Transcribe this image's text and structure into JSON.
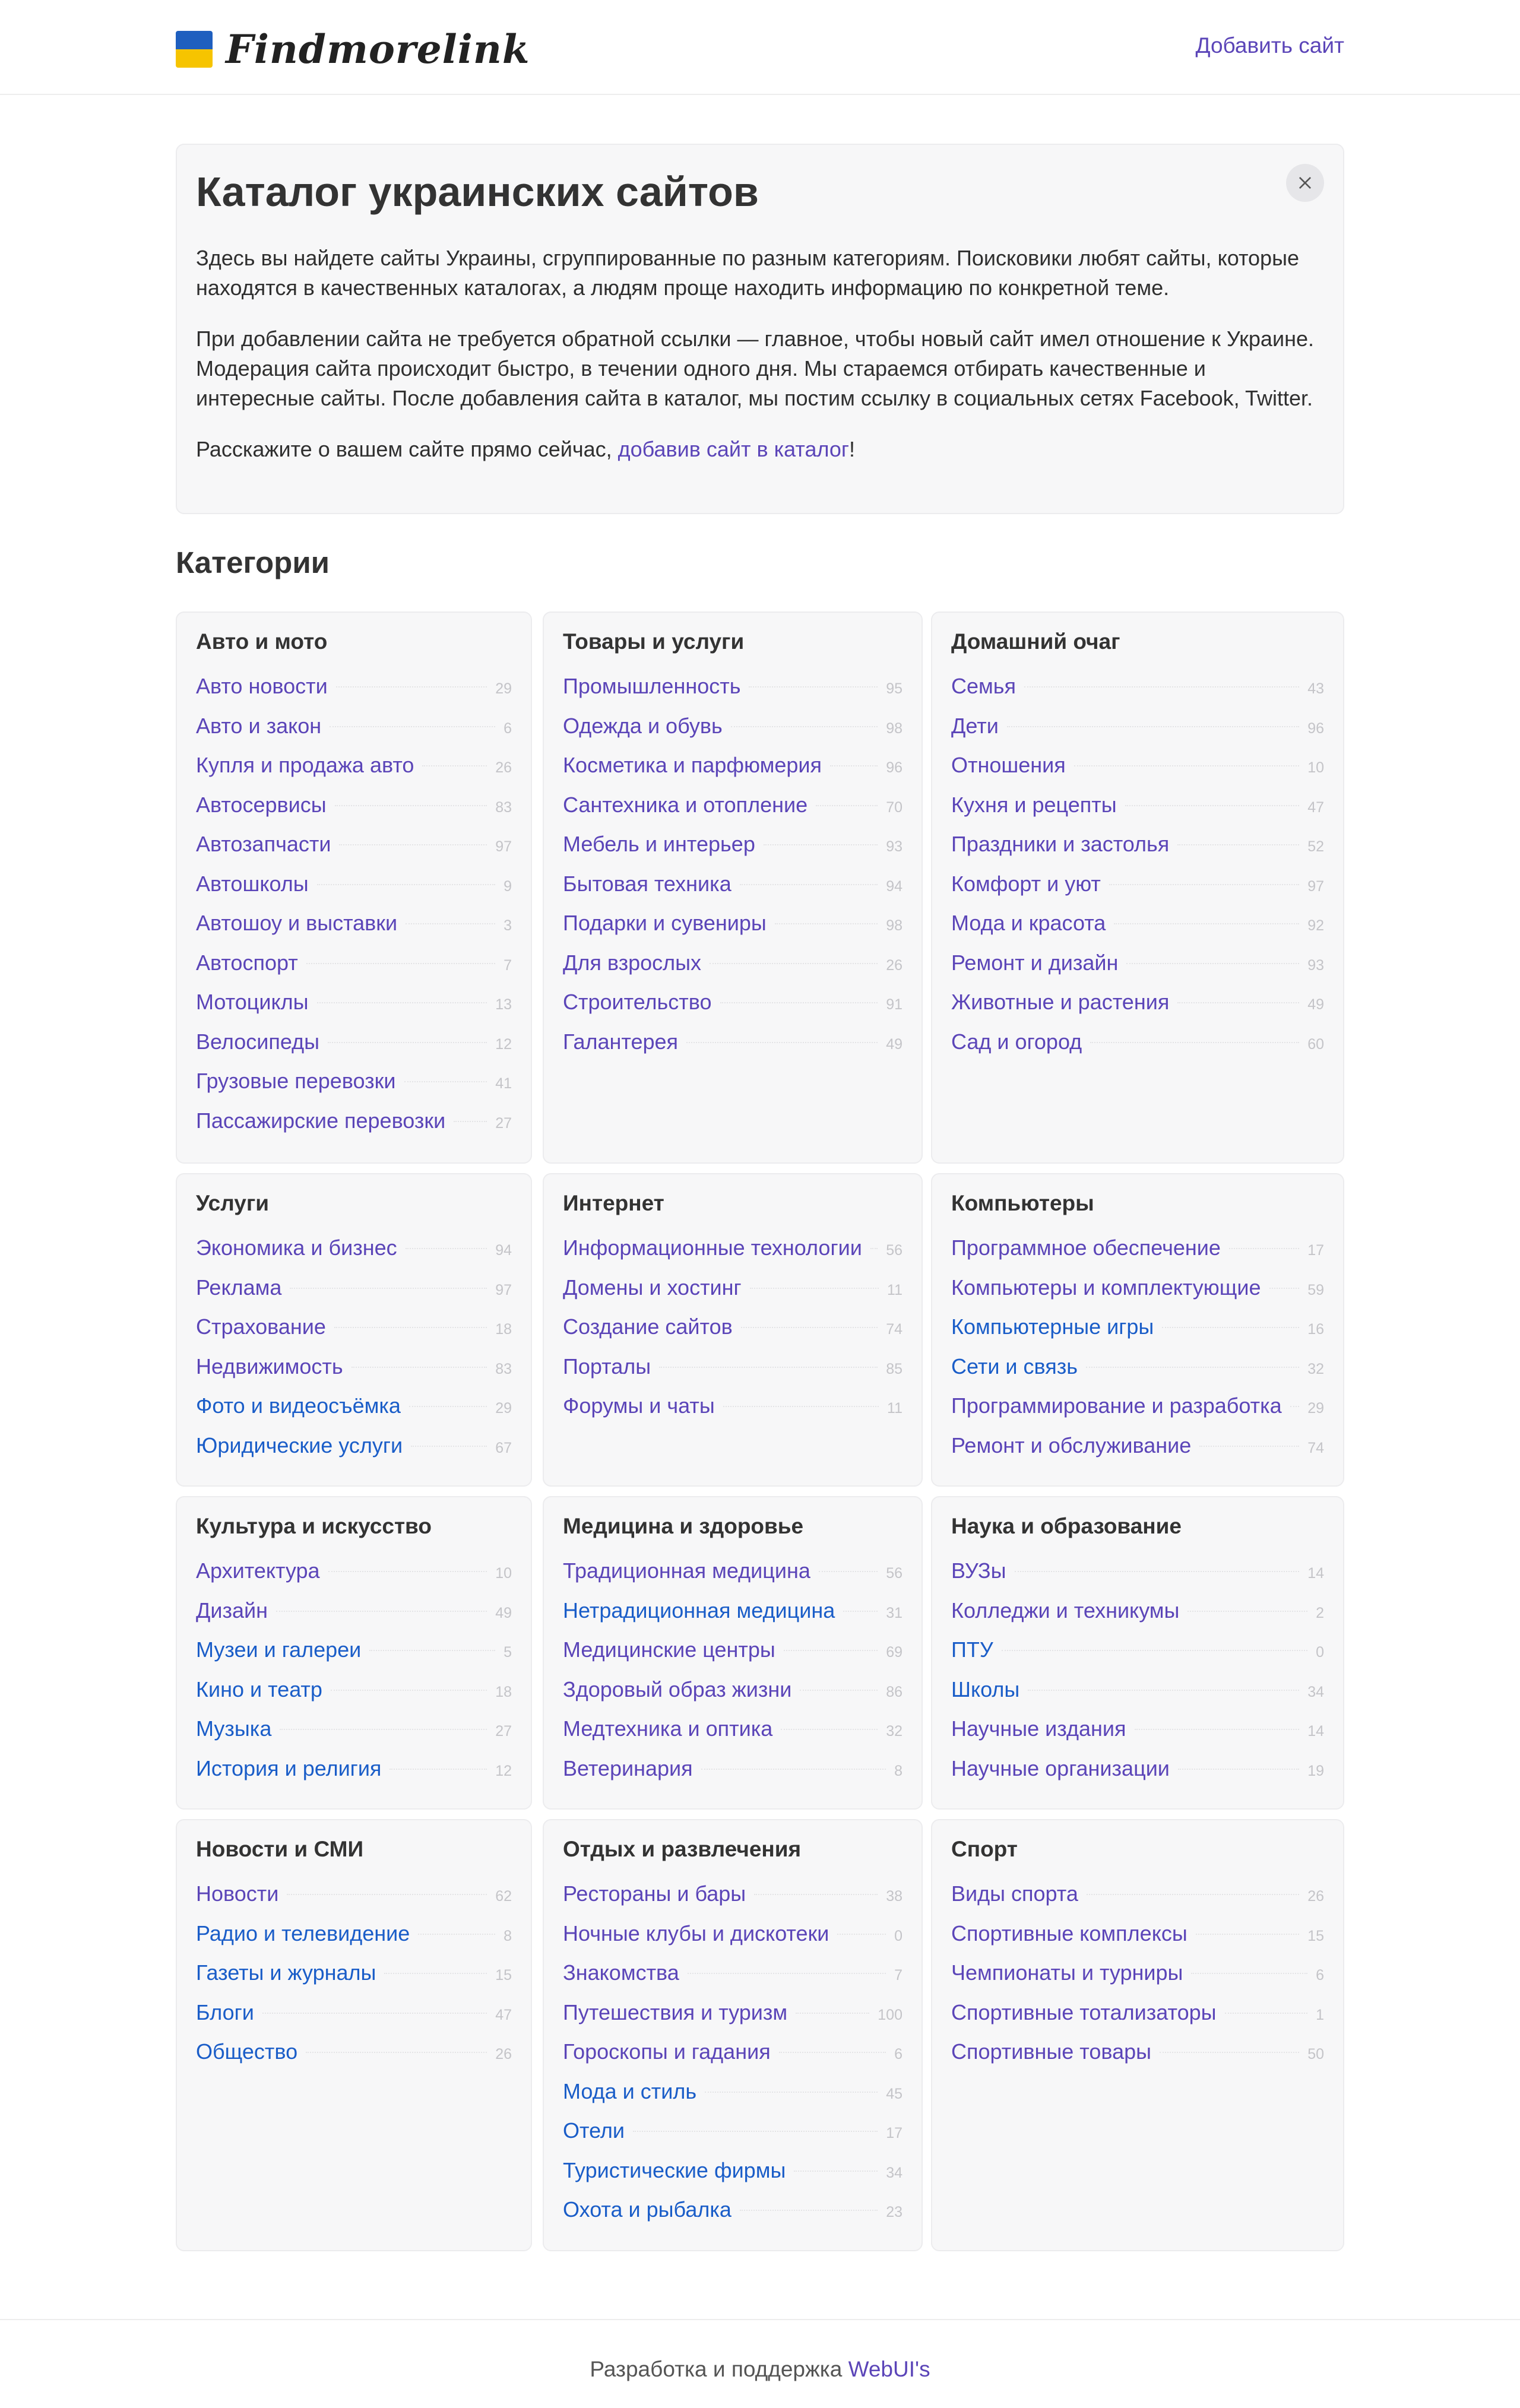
{
  "header": {
    "logo_text": "Findmorelink",
    "add_site": "Добавить сайт",
    "flag_colors": {
      "top": "#1f5fbf",
      "bottom": "#f6c400"
    }
  },
  "intro": {
    "title": "Каталог украинских сайтов",
    "p1": "Здесь вы найдете сайты Украины, сгруппированные по разным категориям. Поисковики любят сайты, которые находятся в качественных каталогах, а людям проще находить информацию по конкретной теме.",
    "p2": "При добавлении сайта не требуется обратной ссылки — главное, чтобы новый сайт имел отношение к Украине. Модерация сайта происходит быстро, в течении одного дня. Мы стараемся отбирать качественные и интересные сайты. После добавления сайта в каталог, мы постим ссылку в социальных сетях Facebook, Twitter.",
    "p3_before": "Расскажите о вашем сайте прямо сейчас, ",
    "p3_link": "добавив сайт в каталог",
    "p3_after": "!"
  },
  "categories_title": "Категории",
  "colors": {
    "link_visited": "#5b45b8",
    "link": "#1a5dc8",
    "count": "#c4c4c8"
  },
  "categories": [
    {
      "title": "Авто и мото",
      "items": [
        {
          "label": "Авто новости",
          "count": "29",
          "color": "purple"
        },
        {
          "label": "Авто и закон",
          "count": "6",
          "color": "purple"
        },
        {
          "label": "Купля и продажа авто",
          "count": "26",
          "color": "purple"
        },
        {
          "label": "Автосервисы",
          "count": "83",
          "color": "purple"
        },
        {
          "label": "Автозапчасти",
          "count": "97",
          "color": "purple"
        },
        {
          "label": "Автошколы",
          "count": "9",
          "color": "purple"
        },
        {
          "label": "Автошоу и выставки",
          "count": "3",
          "color": "purple"
        },
        {
          "label": "Автоспорт",
          "count": "7",
          "color": "purple"
        },
        {
          "label": "Мотоциклы",
          "count": "13",
          "color": "purple"
        },
        {
          "label": "Велосипеды",
          "count": "12",
          "color": "purple"
        },
        {
          "label": "Грузовые перевозки",
          "count": "41",
          "color": "purple"
        },
        {
          "label": "Пассажирские перевозки",
          "count": "27",
          "color": "purple"
        }
      ]
    },
    {
      "title": "Товары и услуги",
      "items": [
        {
          "label": "Промышленность",
          "count": "95",
          "color": "purple"
        },
        {
          "label": "Одежда и обувь",
          "count": "98",
          "color": "purple"
        },
        {
          "label": "Косметика и парфюмерия",
          "count": "96",
          "color": "purple"
        },
        {
          "label": "Сантехника и отопление",
          "count": "70",
          "color": "purple"
        },
        {
          "label": "Мебель и интерьер",
          "count": "93",
          "color": "purple"
        },
        {
          "label": "Бытовая техника",
          "count": "94",
          "color": "purple"
        },
        {
          "label": "Подарки и сувениры",
          "count": "98",
          "color": "purple"
        },
        {
          "label": "Для взрослых",
          "count": "26",
          "color": "purple"
        },
        {
          "label": "Строительство",
          "count": "91",
          "color": "purple"
        },
        {
          "label": "Галантерея",
          "count": "49",
          "color": "purple"
        }
      ]
    },
    {
      "title": "Домашний очаг",
      "items": [
        {
          "label": "Семья",
          "count": "43",
          "color": "purple"
        },
        {
          "label": "Дети",
          "count": "96",
          "color": "purple"
        },
        {
          "label": "Отношения",
          "count": "10",
          "color": "purple"
        },
        {
          "label": "Кухня и рецепты",
          "count": "47",
          "color": "purple"
        },
        {
          "label": "Праздники и застолья",
          "count": "52",
          "color": "purple"
        },
        {
          "label": "Комфорт и уют",
          "count": "97",
          "color": "purple"
        },
        {
          "label": "Мода и красота",
          "count": "92",
          "color": "purple"
        },
        {
          "label": "Ремонт и дизайн",
          "count": "93",
          "color": "purple"
        },
        {
          "label": "Животные и растения",
          "count": "49",
          "color": "purple"
        },
        {
          "label": "Сад и огород",
          "count": "60",
          "color": "purple"
        }
      ]
    },
    {
      "title": "Услуги",
      "items": [
        {
          "label": "Экономика и бизнес",
          "count": "94",
          "color": "purple"
        },
        {
          "label": "Реклама",
          "count": "97",
          "color": "purple"
        },
        {
          "label": "Страхование",
          "count": "18",
          "color": "purple"
        },
        {
          "label": "Недвижимость",
          "count": "83",
          "color": "purple"
        },
        {
          "label": "Фото и видеосъёмка",
          "count": "29",
          "color": "blue"
        },
        {
          "label": "Юридические услуги",
          "count": "67",
          "color": "blue"
        }
      ]
    },
    {
      "title": "Интернет",
      "items": [
        {
          "label": "Информационные технологии",
          "count": "56",
          "color": "purple"
        },
        {
          "label": "Домены и хостинг",
          "count": "11",
          "color": "purple"
        },
        {
          "label": "Создание сайтов",
          "count": "74",
          "color": "purple"
        },
        {
          "label": "Порталы",
          "count": "85",
          "color": "purple"
        },
        {
          "label": "Форумы и чаты",
          "count": "11",
          "color": "purple"
        }
      ]
    },
    {
      "title": "Компьютеры",
      "items": [
        {
          "label": "Программное обеспечение",
          "count": "17",
          "color": "purple"
        },
        {
          "label": "Компьютеры и комплектующие",
          "count": "59",
          "color": "purple"
        },
        {
          "label": "Компьютерные игры",
          "count": "16",
          "color": "blue"
        },
        {
          "label": "Сети и связь",
          "count": "32",
          "color": "blue"
        },
        {
          "label": "Программирование и разработка",
          "count": "29",
          "color": "purple"
        },
        {
          "label": "Ремонт и обслуживание",
          "count": "74",
          "color": "purple"
        }
      ]
    },
    {
      "title": "Культура и искусство",
      "items": [
        {
          "label": "Архитектура",
          "count": "10",
          "color": "purple"
        },
        {
          "label": "Дизайн",
          "count": "49",
          "color": "purple"
        },
        {
          "label": "Музеи и галереи",
          "count": "5",
          "color": "blue"
        },
        {
          "label": "Кино и театр",
          "count": "18",
          "color": "blue"
        },
        {
          "label": "Музыка",
          "count": "27",
          "color": "blue"
        },
        {
          "label": "История и религия",
          "count": "12",
          "color": "blue"
        }
      ]
    },
    {
      "title": "Медицина и здоровье",
      "items": [
        {
          "label": "Традиционная медицина",
          "count": "56",
          "color": "purple"
        },
        {
          "label": "Нетрадиционная медицина",
          "count": "31",
          "color": "blue"
        },
        {
          "label": "Медицинские центры",
          "count": "69",
          "color": "purple"
        },
        {
          "label": "Здоровый образ жизни",
          "count": "86",
          "color": "purple"
        },
        {
          "label": "Медтехника и оптика",
          "count": "32",
          "color": "purple"
        },
        {
          "label": "Ветеринария",
          "count": "8",
          "color": "purple"
        }
      ]
    },
    {
      "title": "Наука и образование",
      "items": [
        {
          "label": "ВУЗы",
          "count": "14",
          "color": "purple"
        },
        {
          "label": "Колледжи и техникумы",
          "count": "2",
          "color": "purple"
        },
        {
          "label": "ПТУ",
          "count": "0",
          "color": "blue"
        },
        {
          "label": "Школы",
          "count": "34",
          "color": "blue"
        },
        {
          "label": "Научные издания",
          "count": "14",
          "color": "purple"
        },
        {
          "label": "Научные организации",
          "count": "19",
          "color": "purple"
        }
      ]
    },
    {
      "title": "Новости и СМИ",
      "items": [
        {
          "label": "Новости",
          "count": "62",
          "color": "purple"
        },
        {
          "label": "Радио и телевидение",
          "count": "8",
          "color": "blue"
        },
        {
          "label": "Газеты и журналы",
          "count": "15",
          "color": "blue"
        },
        {
          "label": "Блоги",
          "count": "47",
          "color": "blue"
        },
        {
          "label": "Общество",
          "count": "26",
          "color": "blue"
        }
      ]
    },
    {
      "title": "Отдых и развлечения",
      "items": [
        {
          "label": "Рестораны и бары",
          "count": "38",
          "color": "purple"
        },
        {
          "label": "Ночные клубы и дискотеки",
          "count": "0",
          "color": "purple"
        },
        {
          "label": "Знакомства",
          "count": "7",
          "color": "purple"
        },
        {
          "label": "Путешествия и туризм",
          "count": "100",
          "color": "purple"
        },
        {
          "label": "Гороскопы и гадания",
          "count": "6",
          "color": "purple"
        },
        {
          "label": "Мода и стиль",
          "count": "45",
          "color": "blue"
        },
        {
          "label": "Отели",
          "count": "17",
          "color": "blue"
        },
        {
          "label": "Туристические фирмы",
          "count": "34",
          "color": "blue"
        },
        {
          "label": "Охота и рыбалка",
          "count": "23",
          "color": "blue"
        }
      ]
    },
    {
      "title": "Спорт",
      "items": [
        {
          "label": "Виды спорта",
          "count": "26",
          "color": "purple"
        },
        {
          "label": "Спортивные комплексы",
          "count": "15",
          "color": "purple"
        },
        {
          "label": "Чемпионаты и турниры",
          "count": "6",
          "color": "purple"
        },
        {
          "label": "Спортивные тотализаторы",
          "count": "1",
          "color": "purple"
        },
        {
          "label": "Спортивные товары",
          "count": "50",
          "color": "purple"
        }
      ]
    }
  ],
  "footer": {
    "text": "Разработка и поддержка ",
    "link": "WebUI's"
  }
}
